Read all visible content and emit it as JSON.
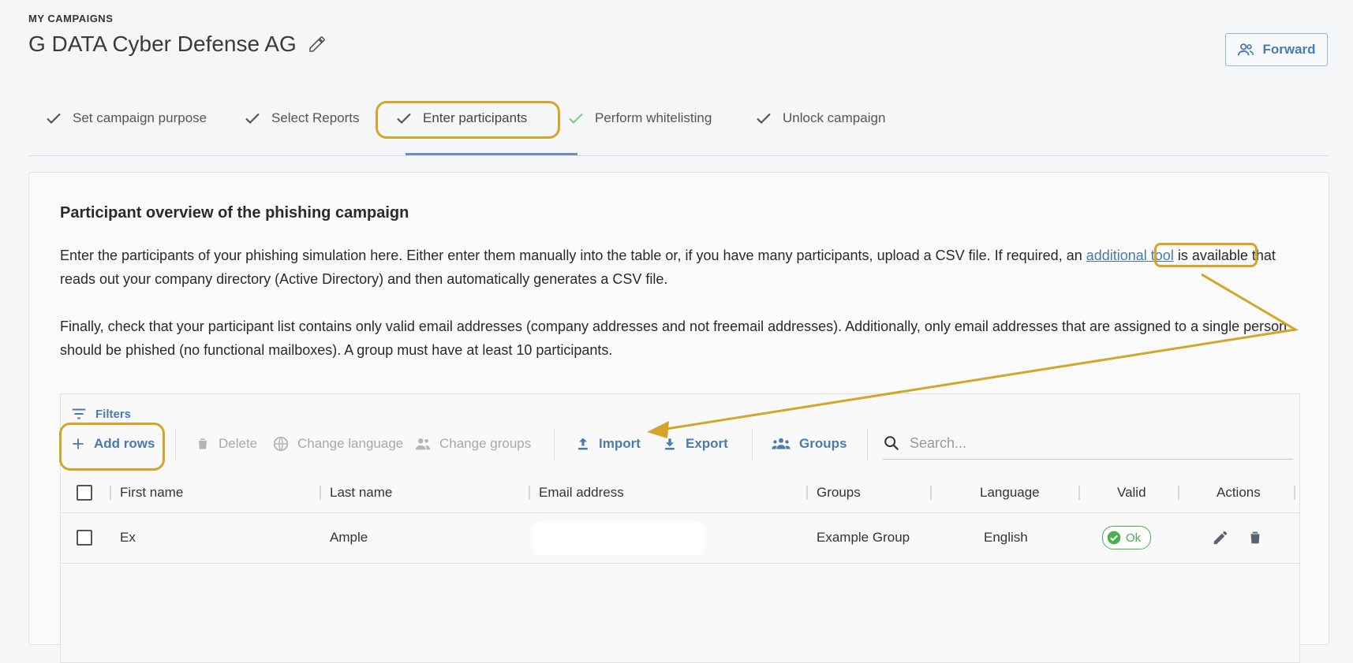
{
  "header": {
    "breadcrumb": "MY CAMPAIGNS",
    "title": "G DATA Cyber Defense AG",
    "forward_label": "Forward"
  },
  "tabs": [
    {
      "label": "Set campaign purpose"
    },
    {
      "label": "Select Reports"
    },
    {
      "label": "Enter participants"
    },
    {
      "label": "Perform whitelisting"
    },
    {
      "label": "Unlock campaign"
    }
  ],
  "card": {
    "heading": "Participant overview of the phishing campaign",
    "para1_before": "Enter the participants of your phishing simulation here. Either enter them manually into the table or, if you have many participants, upload a CSV file. If required, an ",
    "para1_link": "additional tool",
    "para1_after": " is available that reads out your company directory (Active Directory) and then automatically generates a CSV file.",
    "para2": "Finally, check that your participant list contains only valid email addresses (company addresses and not freemail addresses). Additionally, only email addresses that are assigned to a single person should be phished (no functional mailboxes). A group must have at least 10 participants."
  },
  "toolbar": {
    "filters": "Filters",
    "add_rows": "Add rows",
    "delete": "Delete",
    "change_language": "Change language",
    "change_groups": "Change groups",
    "import": "Import",
    "export": "Export",
    "groups": "Groups",
    "search_placeholder": "Search..."
  },
  "table": {
    "columns": [
      "First name",
      "Last name",
      "Email address",
      "Groups",
      "Language",
      "Valid",
      "Actions"
    ],
    "rows": [
      {
        "first_name": "Ex",
        "last_name": "Ample",
        "email": "",
        "groups": "Example Group",
        "language": "English",
        "valid": "Ok"
      }
    ]
  },
  "colors": {
    "accent": "#4a7ab0",
    "highlight": "#d4a52a",
    "success": "#4caf50",
    "disabled": "#a8a8a8"
  }
}
